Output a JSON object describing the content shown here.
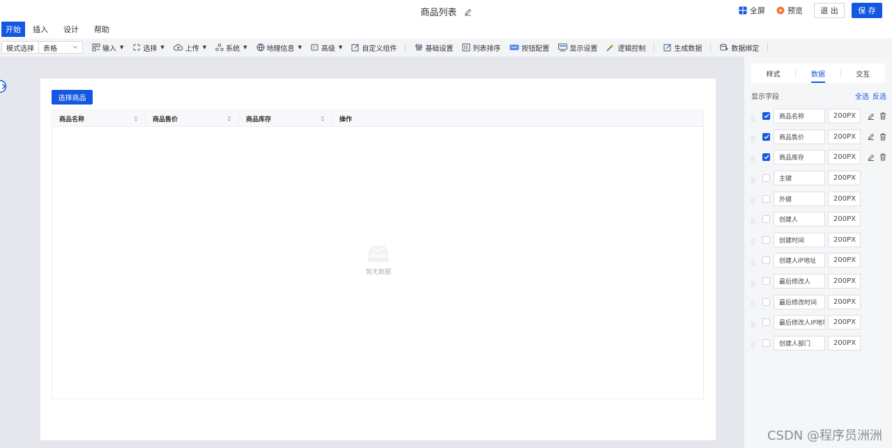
{
  "header": {
    "title": "商品列表",
    "fullscreen_label": "全屏",
    "preview_label": "预览",
    "exit_label": "退 出",
    "save_label": "保 存"
  },
  "menu": {
    "tabs": [
      {
        "label": "开始",
        "active": true
      },
      {
        "label": "插入"
      },
      {
        "label": "设计"
      },
      {
        "label": "帮助"
      }
    ]
  },
  "toolbar": {
    "mode_label": "模式选择",
    "mode_value": "表格",
    "items": [
      "输入",
      "选择",
      "上传",
      "系统",
      "地理信息",
      "高级",
      "自定义组件",
      "基础设置",
      "列表排序",
      "按钮配置",
      "显示设置",
      "逻辑控制",
      "生成数据",
      "数据绑定"
    ]
  },
  "canvas": {
    "choose_button": "选择商品",
    "columns": [
      "商品名称",
      "商品售价",
      "商品库存",
      "操作"
    ],
    "empty_text": "暂无数据"
  },
  "right_panel": {
    "tabs": [
      "样式",
      "数据",
      "交互"
    ],
    "active_tab": "数据",
    "section_label": "显示字段",
    "select_all": "全选",
    "invert": "反选",
    "fields": [
      {
        "name": "商品名称",
        "width": "200PX",
        "checked": true
      },
      {
        "name": "商品售价",
        "width": "200PX",
        "checked": true
      },
      {
        "name": "商品库存",
        "width": "200PX",
        "checked": true
      },
      {
        "name": "主键",
        "width": "200PX",
        "checked": false
      },
      {
        "name": "外键",
        "width": "200PX",
        "checked": false
      },
      {
        "name": "创建人",
        "width": "200PX",
        "checked": false
      },
      {
        "name": "创建时间",
        "width": "200PX",
        "checked": false
      },
      {
        "name": "创建人IP地址",
        "width": "200PX",
        "checked": false
      },
      {
        "name": "最后修改人",
        "width": "200PX",
        "checked": false
      },
      {
        "name": "最后修改时间",
        "width": "200PX",
        "checked": false
      },
      {
        "name": "最后修改人IP地址",
        "width": "200PX",
        "checked": false
      },
      {
        "name": "创建人部门",
        "width": "200PX",
        "checked": false
      }
    ]
  },
  "watermark": "CSDN @程序员洲洲",
  "colors": {
    "primary": "#1457e3",
    "canvas_bg": "#e5e7ec",
    "panel_bg": "#f5f6f8"
  }
}
